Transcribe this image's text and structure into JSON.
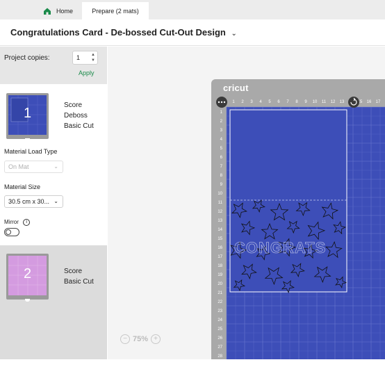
{
  "tabs": {
    "home_label": "Home",
    "prepare_label": "Prepare (2 mats)"
  },
  "project": {
    "title": "Congratulations Card - De-bossed Cut-Out Design"
  },
  "copies": {
    "label": "Project copies:",
    "value": "1",
    "apply_label": "Apply"
  },
  "mats": [
    {
      "number": "1",
      "color": "#3d4eb8",
      "operations": [
        "Score",
        "Deboss",
        "Basic Cut"
      ]
    },
    {
      "number": "2",
      "color": "#d49be0",
      "operations": [
        "Score",
        "Basic Cut"
      ]
    }
  ],
  "settings": {
    "load_type_label": "Material Load Type",
    "load_type_value": "On Mat",
    "size_label": "Material Size",
    "size_value": "30.5 cm x 30...",
    "mirror_label": "Mirror",
    "mirror_on": false
  },
  "canvas": {
    "brand": "cricut",
    "zoom_label": "75%",
    "top_ruler": [
      "1",
      "2",
      "3",
      "4",
      "5",
      "6",
      "7",
      "8",
      "9",
      "10",
      "11",
      "12",
      "13",
      "14",
      "15",
      "16",
      "17"
    ],
    "left_ruler": [
      "1",
      "2",
      "3",
      "4",
      "5",
      "6",
      "7",
      "8",
      "9",
      "10",
      "11",
      "12",
      "13",
      "14",
      "15",
      "16",
      "17",
      "18",
      "19",
      "20",
      "21",
      "22",
      "23",
      "24",
      "25",
      "26",
      "27",
      "28"
    ],
    "selected_label": "CONGRATS"
  },
  "colors": {
    "mat_blue": "#3d4eb8",
    "mat_frame": "#a9a9a9",
    "accent_green": "#1a8a4a"
  }
}
